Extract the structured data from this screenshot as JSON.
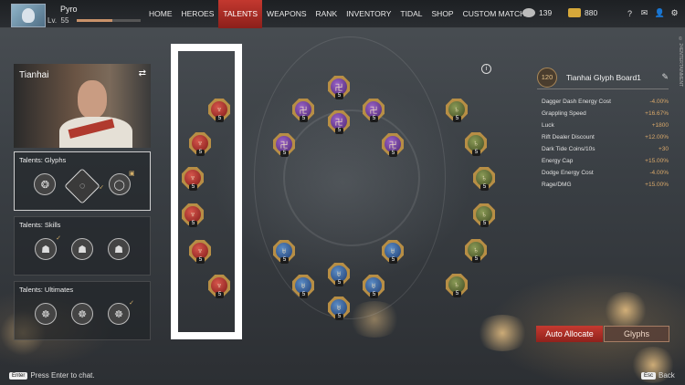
{
  "player": {
    "name": "Pyro",
    "level_label": "Lv.",
    "level": "55",
    "xp_fraction": 0.55
  },
  "nav": {
    "tabs": [
      "HOME",
      "HEROES",
      "TALENTS",
      "WEAPONS",
      "RANK",
      "INVENTORY",
      "TIDAL",
      "SHOP",
      "CUSTOM MATCH"
    ],
    "active": "TALENTS"
  },
  "currency": {
    "a": "139",
    "b": "880"
  },
  "hero": {
    "name": "Tianhai"
  },
  "talents": {
    "glyphs_title": "Talents: Glyphs",
    "skills_title": "Talents: Skills",
    "ultimates_title": "Talents: Ultimates"
  },
  "glyph_level": "5",
  "glyph_colors": {
    "red": "#a42a23",
    "purple": "#6a3b95",
    "blue": "#2f5a96",
    "green": "#5e6b35"
  },
  "board": {
    "level": "120",
    "title": "Tianhai Glyph Board1",
    "stats": [
      {
        "label": "Dagger Dash Energy Cost",
        "value": "-4.00%"
      },
      {
        "label": "Grappling Speed",
        "value": "+16.67%"
      },
      {
        "label": "Luck",
        "value": "+1800"
      },
      {
        "label": "Rift Dealer Discount",
        "value": "+12.00%"
      },
      {
        "label": "Dark Tide Coins/10s",
        "value": "+30"
      },
      {
        "label": "Energy Cap",
        "value": "+15.00%"
      },
      {
        "label": "Dodge Energy Cost",
        "value": "-4.00%"
      },
      {
        "label": "Rage/DMG",
        "value": "+15.00%"
      }
    ]
  },
  "buttons": {
    "auto_allocate": "Auto Allocate",
    "glyphs": "Glyphs"
  },
  "footer": {
    "enter_key": "Enter",
    "chat_hint": "Press Enter to chat.",
    "esc_key": "Esc",
    "back": "Back"
  },
  "icons": [
    "gear-icon",
    "mail-icon",
    "friends-icon",
    "help-icon",
    "info-icon",
    "edit-icon",
    "swap-icon"
  ]
}
